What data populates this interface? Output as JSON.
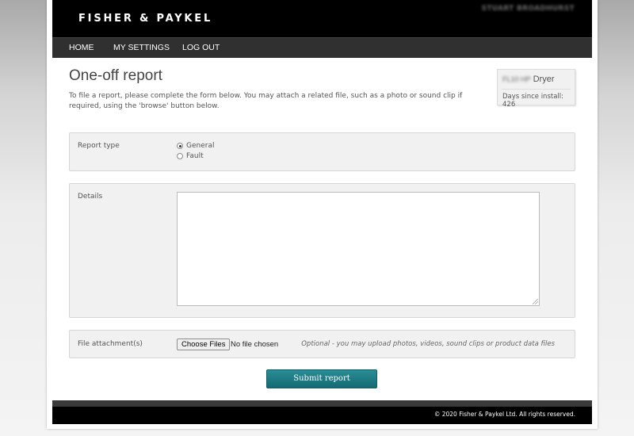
{
  "header": {
    "logo": "FISHER & PAYKEL",
    "username": "STUART BROADHURST"
  },
  "nav": {
    "items": [
      {
        "label": "HOME"
      },
      {
        "label": "MY SETTINGS"
      },
      {
        "label": "LOG OUT"
      }
    ]
  },
  "page": {
    "title": "One-off report",
    "intro": "To file a report, please complete the form below. You may attach a related file, such as a photo or sound clip if required, using the 'browse' button below."
  },
  "product": {
    "model": "FL10 HP",
    "type": "Dryer",
    "days_since_install": "Days since install: 426"
  },
  "form": {
    "report_type": {
      "label": "Report type",
      "options": [
        {
          "label": "General",
          "checked": true
        },
        {
          "label": "Fault",
          "checked": false
        }
      ]
    },
    "details": {
      "label": "Details",
      "value": ""
    },
    "attachment": {
      "label": "File attachment(s)",
      "button_label": "Choose Files",
      "status": "No file chosen",
      "hint": "Optional - you may upload photos, videos, sound clips or product data files"
    },
    "submit_label": "Submit report"
  },
  "footer": {
    "copyright": "© 2020 Fisher & Paykel Ltd. All rights reserved."
  },
  "colors": {
    "accent": "#1e7c85",
    "header_bg": "#000000",
    "nav_bg": "#303030"
  }
}
